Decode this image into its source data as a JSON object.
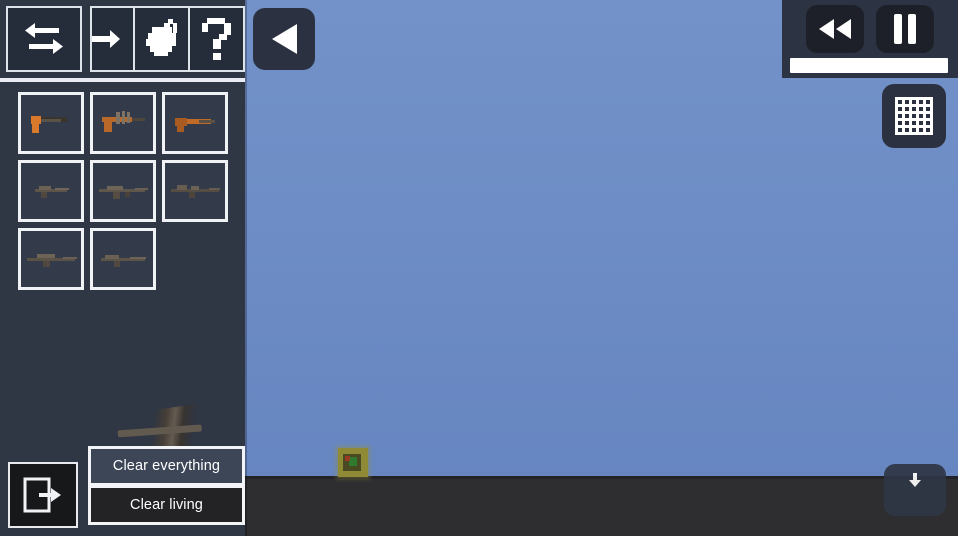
{
  "app": {
    "title": "Sandbox Weapon Selector",
    "colors": {
      "sky": "#6b8ac4",
      "ground": "#2e2e30",
      "panel": "#2f3644",
      "tile_border": "#f0f2f6",
      "button_highlight": "#3c4657",
      "button_dark": "#232325",
      "slider_fill": "#ffffff"
    }
  },
  "left_panel": {
    "toolbar": {
      "items": [
        {
          "name": "swap-tool",
          "icon": "swap-arrows-icon",
          "label": "Swap"
        },
        {
          "name": "indent-tool",
          "icon": "arrow-into-wall-icon",
          "label": "Align"
        },
        {
          "name": "paint-tool",
          "icon": "paint-bucket-icon",
          "label": "Paint"
        },
        {
          "name": "help-tool",
          "icon": "question-mark-icon",
          "label": "Help"
        }
      ]
    },
    "weapons": [
      {
        "name": "pistol",
        "label": "Pistol",
        "row": 1,
        "col": 1
      },
      {
        "name": "smg",
        "label": "SMG",
        "row": 1,
        "col": 2
      },
      {
        "name": "sawn-off",
        "label": "Sawn-off",
        "row": 1,
        "col": 3
      },
      {
        "name": "machine-gun",
        "label": "Machine Gun",
        "row": 2,
        "col": 1
      },
      {
        "name": "assault-rifle",
        "label": "Assault Rifle",
        "row": 2,
        "col": 2
      },
      {
        "name": "battle-rifle",
        "label": "Battle Rifle",
        "row": 2,
        "col": 3
      },
      {
        "name": "sniper-rifle",
        "label": "Sniper Rifle",
        "row": 3,
        "col": 1
      },
      {
        "name": "shotgun",
        "label": "Shotgun",
        "row": 3,
        "col": 2
      }
    ],
    "exit_button": {
      "icon": "exit-icon",
      "label": "Exit"
    },
    "clear_everything_label": "Clear everything",
    "clear_living_label": "Clear living"
  },
  "overlay": {
    "back_button": {
      "icon": "play-left-triangle-icon",
      "label": "Back"
    },
    "rewind_button": {
      "icon": "rewind-icon",
      "label": "Rewind"
    },
    "pause_button": {
      "icon": "pause-icon",
      "label": "Pause"
    },
    "speed_slider": {
      "value": 100,
      "label": "Speed"
    },
    "grid_button": {
      "icon": "grid-icon",
      "label": "Grid"
    },
    "download_button": {
      "icon": "download-icon",
      "label": "Download"
    }
  },
  "world": {
    "crate": {
      "name": "crate-object",
      "label": "Crate"
    }
  }
}
